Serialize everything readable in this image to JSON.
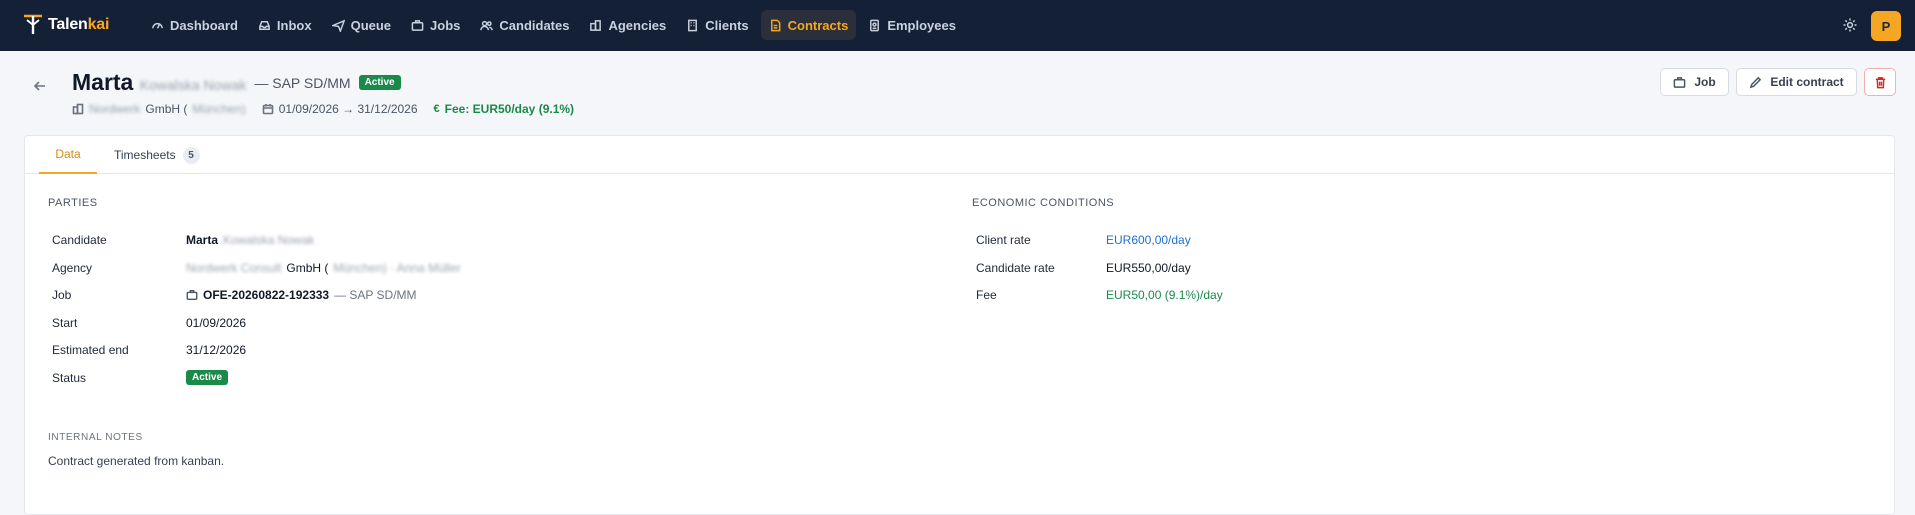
{
  "app": {
    "brand_prefix": "Talen",
    "brand_suffix": "kai",
    "avatar_initial": "P"
  },
  "nav": [
    {
      "label": "Dashboard",
      "icon": "dashboard-icon"
    },
    {
      "label": "Inbox",
      "icon": "inbox-icon"
    },
    {
      "label": "Queue",
      "icon": "send-icon"
    },
    {
      "label": "Jobs",
      "icon": "briefcase-icon"
    },
    {
      "label": "Candidates",
      "icon": "users-icon"
    },
    {
      "label": "Agencies",
      "icon": "building-icon"
    },
    {
      "label": "Clients",
      "icon": "building-icon"
    },
    {
      "label": "Contracts",
      "icon": "document-icon",
      "active": true
    },
    {
      "label": "Employees",
      "icon": "badge-icon"
    }
  ],
  "header": {
    "name_first": "Marta",
    "name_hidden": "Kowalska Nowak",
    "subtitle": "— SAP SD/MM",
    "status": "Active",
    "company_hidden": "Nordwerk",
    "company_suffix": "GmbH (",
    "company_hidden_tail": "München)",
    "period": "01/09/2026 → 31/12/2026",
    "fee_symbol": "€",
    "fee": "Fee: EUR50/day (9.1%)"
  },
  "actions": {
    "job": "Job",
    "edit": "Edit contract"
  },
  "tabs": {
    "data": "Data",
    "timesheets": "Timesheets",
    "timesheets_count": "5"
  },
  "parties": {
    "title": "PARTIES",
    "rows": {
      "candidate_label": "Candidate",
      "candidate_first": "Marta",
      "candidate_hidden": "Kowalska Nowak",
      "agency_label": "Agency",
      "agency_hidden_head": "Nordwerk Consult",
      "agency_mid": "GmbH (",
      "agency_hidden_tail": "München) · Anna Müller",
      "job_label": "Job",
      "job_code": "OFE-20260822-192333",
      "job_title": "— SAP SD/MM",
      "start_label": "Start",
      "start_value": "01/09/2026",
      "end_label": "Estimated end",
      "end_value": "31/12/2026",
      "status_label": "Status",
      "status_value": "Active"
    }
  },
  "economic": {
    "title": "ECONOMIC CONDITIONS",
    "client_rate_label": "Client rate",
    "client_rate_value": "EUR600,00/day",
    "candidate_rate_label": "Candidate rate",
    "candidate_rate_value": "EUR550,00/day",
    "fee_label": "Fee",
    "fee_value": "EUR50,00 (9.1%)/day"
  },
  "notes": {
    "title": "INTERNAL NOTES",
    "text": "Contract generated from kanban."
  },
  "colors": {
    "nav_bg": "#132036",
    "accent": "#f5a623",
    "success": "#1a8a4a",
    "link": "#1d6fd6",
    "danger": "#dc2626"
  }
}
